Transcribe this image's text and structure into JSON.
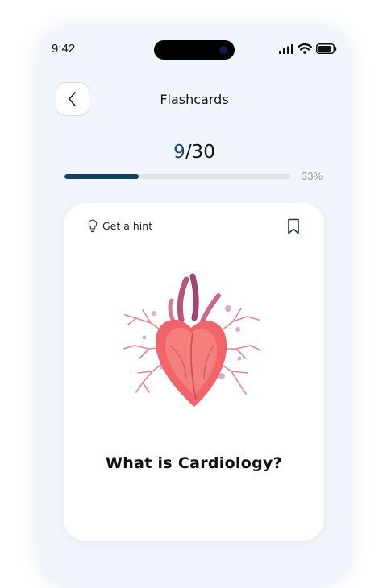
{
  "status_bar": {
    "time": "9:42",
    "icons": [
      "signal-icon",
      "wifi-icon",
      "battery-icon"
    ]
  },
  "header": {
    "title": "Flashcards",
    "back_icon": "chevron-left-icon"
  },
  "progress": {
    "current": "9",
    "total_text": "/30",
    "percent_text": "33%",
    "fraction": 0.33
  },
  "card": {
    "hint_label": "Get a hint",
    "hint_icon": "lightbulb-icon",
    "bookmark_icon": "bookmark-icon",
    "image_subject": "heart-illustration",
    "question": "What is Cardiology?"
  },
  "colors": {
    "accent": "#17405e",
    "background": "#f1f6fc",
    "track": "#dfe2e6"
  }
}
